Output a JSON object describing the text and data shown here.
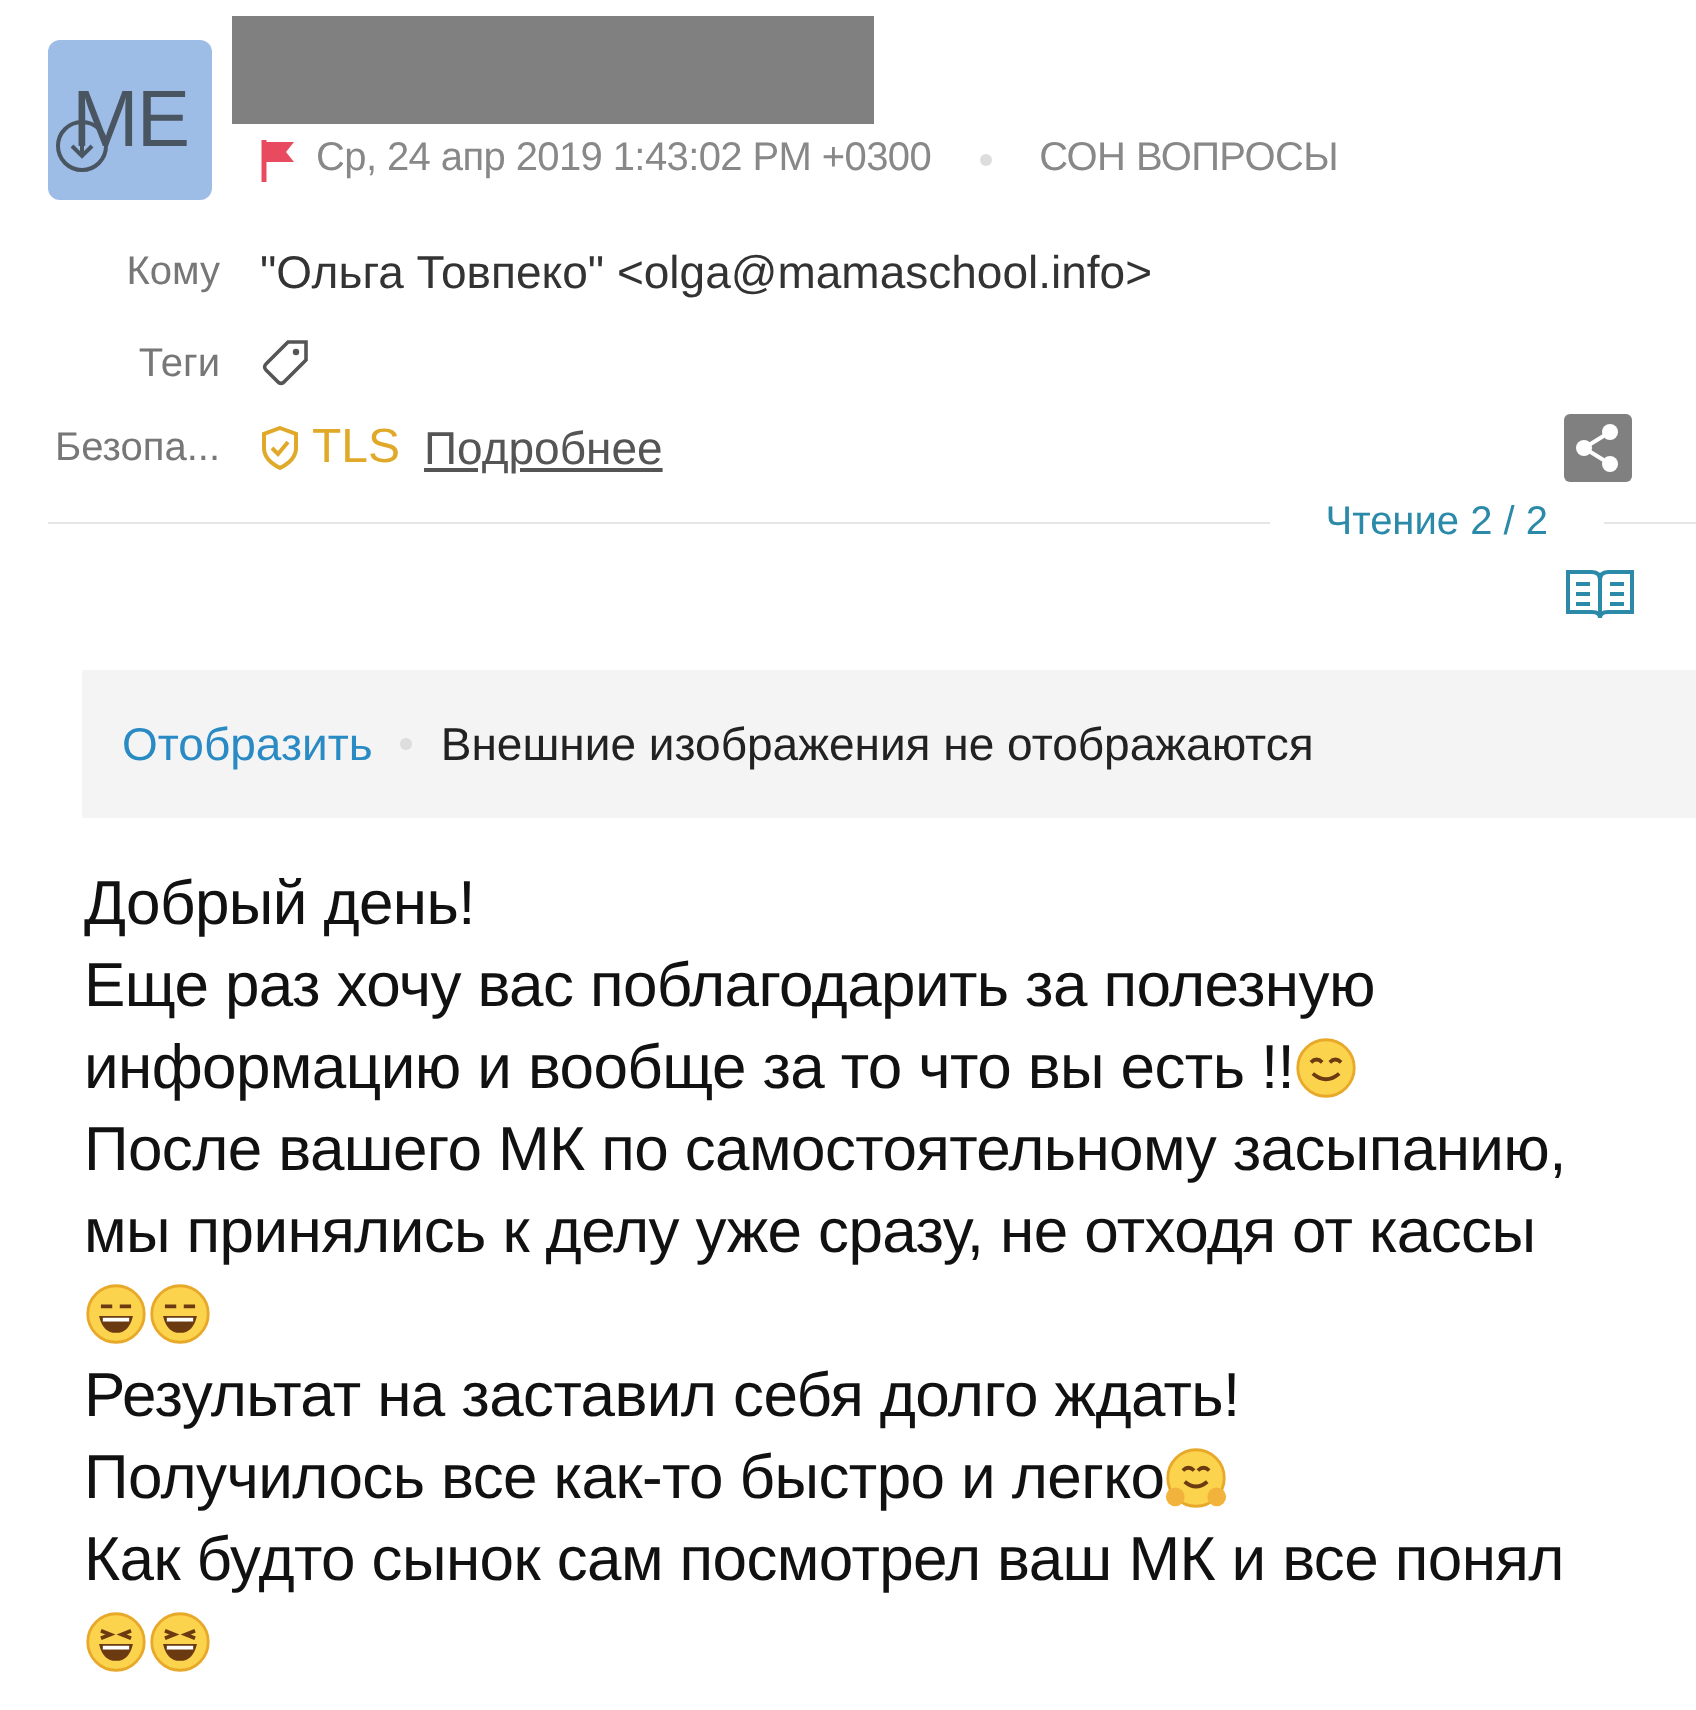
{
  "sender": {
    "initials": "ME",
    "redacted": true
  },
  "meta": {
    "flagged": true,
    "date": "Ср, 24 апр 2019 1:43:02 PM +0300",
    "folder": "СОН ВОПРОСЫ"
  },
  "fields": [
    {
      "kind": "text",
      "label": "Кому",
      "value": "\"Ольга Товпеко\" <olga@mamaschool.info>"
    },
    {
      "kind": "tags",
      "label": "Теги"
    },
    {
      "kind": "security",
      "label": "Безопа...",
      "value": "TLS",
      "link": "Подробнее"
    }
  ],
  "reading": {
    "label": "Чтение 2 / 2"
  },
  "images_banner": {
    "action": "Отобразить",
    "message": "Внешние изображения не отображаются"
  },
  "body": [
    {
      "text": "Добрый день!"
    },
    {
      "text": "Еще раз хочу вас поблагодарить за полезную"
    },
    {
      "text": "информацию и вообще за то что вы есть !!",
      "emoji": [
        {
          "kind": "smile"
        }
      ]
    },
    {
      "text": "После вашего МК по самостоятельному засыпанию,"
    },
    {
      "text": "мы принялись к делу уже сразу, не отходя от кассы"
    },
    {
      "emoji": [
        {
          "kind": "grin"
        },
        {
          "kind": "grin"
        }
      ]
    },
    {
      "text": "Результат на заставил себя долго ждать!"
    },
    {
      "text": "Получилось все как-то быстро и легко",
      "emoji": [
        {
          "kind": "hug"
        }
      ]
    },
    {
      "text": "Как будто сынок сам посмотрел ваш МК и все понял"
    },
    {
      "emoji": [
        {
          "kind": "laugh"
        },
        {
          "kind": "laugh"
        }
      ]
    }
  ]
}
